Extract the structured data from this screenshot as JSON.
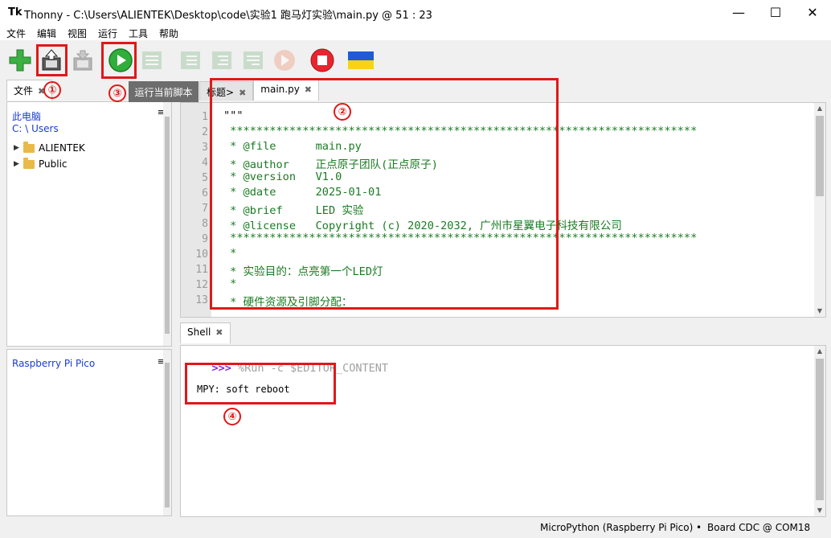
{
  "window": {
    "app_icon": "Tk",
    "title": "Thonny  -  C:\\Users\\ALIENTEK\\Desktop\\code\\实验1 跑马灯实验\\main.py  @  51 : 23",
    "minimize": "—",
    "maximize": "☐",
    "close": "✕"
  },
  "menu": [
    "文件",
    "编辑",
    "视图",
    "运行",
    "工具",
    "帮助"
  ],
  "toolbar": {
    "icons": [
      "new-file-icon",
      "open-file-icon",
      "save-file-icon",
      "run-icon",
      "debug-icon",
      "step-over-icon",
      "step-into-icon",
      "step-out-icon",
      "resume-icon",
      "stop-icon",
      "ukraine-flag-icon"
    ],
    "tooltip": "运行当前脚本"
  },
  "callouts": [
    "①",
    "②",
    "③",
    "④"
  ],
  "files_panel": {
    "tab": "文件",
    "close": "✖",
    "menu": "≡",
    "this_pc": "此电脑",
    "path": "C: \\ Users",
    "items": [
      "ALIENTEK",
      "Public"
    ],
    "device_title": "Raspberry Pi Pico",
    "device_menu": "≡"
  },
  "editor": {
    "tabs": [
      {
        "label": "标题>",
        "close": "✖"
      },
      {
        "label": "main.py",
        "close": "✖"
      }
    ],
    "line_numbers": [
      "1",
      "2",
      "3",
      "4",
      "5",
      "6",
      "7",
      "8",
      "9",
      "10",
      "11",
      "12",
      "13"
    ],
    "lines": [
      "\"\"\"",
      " ***********************************************************************",
      " * @file      main.py",
      " * @author    正点原子团队(正点原子)",
      " * @version   V1.0",
      " * @date      2025-01-01",
      " * @brief     LED 实验",
      " * @license   Copyright (c) 2020-2032, 广州市星翼电子科技有限公司",
      " ***********************************************************************",
      " *",
      " * 实验目的：点亮第一个LED灯",
      " *",
      " * 硬件资源及引脚分配："
    ]
  },
  "shell": {
    "tab": "Shell",
    "close": "✖",
    "prompt": ">>>",
    "command": " %Run -c $EDITOR_CONTENT",
    "output": "MPY: soft reboot"
  },
  "status": {
    "interpreter": "MicroPython (Raspberry Pi Pico)",
    "separator": "•",
    "port": "Board CDC @ COM18"
  },
  "colors": {
    "annotation_red": "#e01818",
    "comment_green": "#1a7b22",
    "prompt_purple": "#8a2be2",
    "link_blue": "#1a3ccf"
  }
}
